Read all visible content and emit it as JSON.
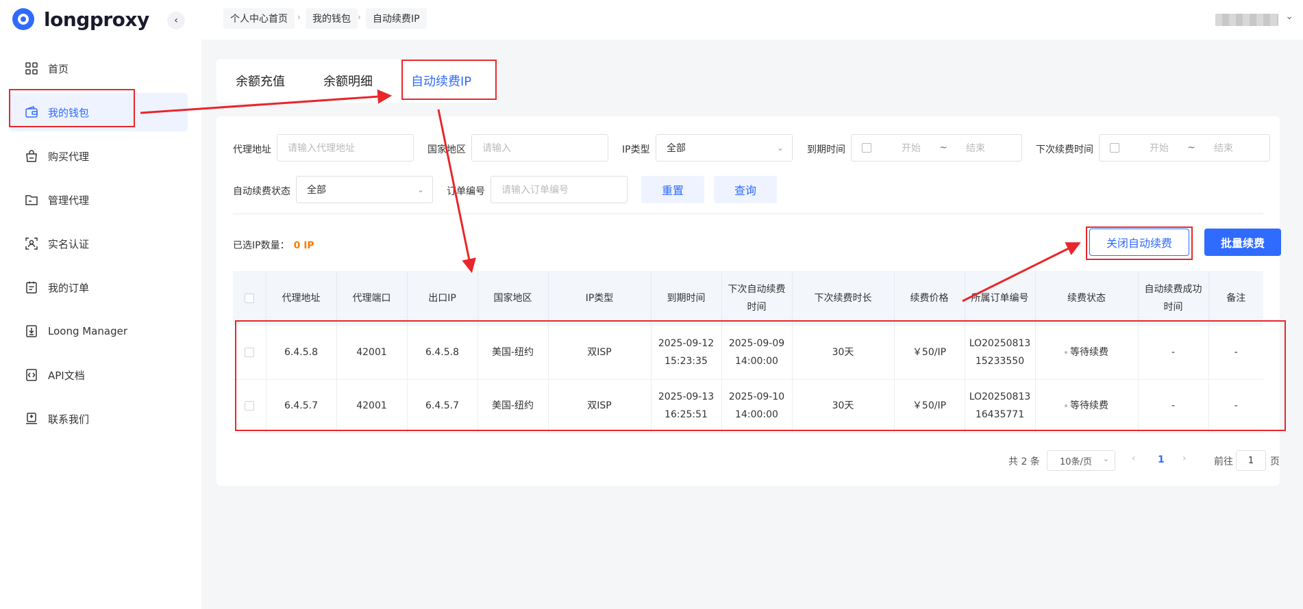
{
  "app": {
    "logo_part1": "lo",
    "logo_o": "o",
    "logo_part2": "ngproxy"
  },
  "sidebar": {
    "items": [
      {
        "label": "首页",
        "icon": "grid-icon"
      },
      {
        "label": "我的钱包",
        "icon": "wallet-icon"
      },
      {
        "label": "购买代理",
        "icon": "shopping-bag-icon"
      },
      {
        "label": "管理代理",
        "icon": "folder-icon"
      },
      {
        "label": "实名认证",
        "icon": "id-scan-icon"
      },
      {
        "label": "我的订单",
        "icon": "clipboard-icon"
      },
      {
        "label": "Loong Manager",
        "icon": "download-icon"
      },
      {
        "label": "API文档",
        "icon": "code-doc-icon"
      },
      {
        "label": "联系我们",
        "icon": "contact-icon"
      }
    ],
    "active_index": 1
  },
  "breadcrumb": [
    "个人中心首页",
    "我的钱包",
    "自动续费IP"
  ],
  "tabs": [
    {
      "label": "余额充值"
    },
    {
      "label": "余额明细"
    },
    {
      "label": "自动续费IP"
    }
  ],
  "filters": {
    "proxy_address": {
      "label": "代理地址",
      "placeholder": "请输入代理地址"
    },
    "country": {
      "label": "国家地区",
      "placeholder": "请输入"
    },
    "ip_type": {
      "label": "IP类型",
      "value": "全部"
    },
    "expire_time": {
      "label": "到期时间",
      "start": "开始",
      "sep": "~",
      "end": "结束"
    },
    "next_renew_time": {
      "label": "下次续费时间",
      "start": "开始",
      "sep": "~",
      "end": "结束"
    },
    "auto_renew_status": {
      "label": "自动续费状态",
      "value": "全部"
    },
    "order_no": {
      "label": "订单编号",
      "placeholder": "请输入订单编号"
    },
    "reset_label": "重置",
    "query_label": "查询"
  },
  "selection": {
    "label": "已选IP数量：",
    "count": "0 IP"
  },
  "actions": {
    "close_auto_renew": "关闭自动续费",
    "batch_renew": "批量续费"
  },
  "table": {
    "headers": [
      "代理地址",
      "代理端口",
      "出口IP",
      "国家地区",
      "IP类型",
      "到期时间",
      "下次自动续费时间",
      "下次续费时长",
      "续费价格",
      "所属订单编号",
      "续费状态",
      "自动续费成功时间",
      "备注"
    ],
    "rows": [
      {
        "address": "6.4.5.8",
        "port": "42001",
        "exit_ip": "6.4.5.8",
        "region": "美国-纽约",
        "type": "双ISP",
        "expire_date": "2025-09-12",
        "expire_time": "15:23:35",
        "next_date": "2025-09-09",
        "next_time": "14:00:00",
        "duration": "30天",
        "price": "￥50/IP",
        "order_a": "LO20250813",
        "order_b": "15233550",
        "status": "等待续费",
        "success_time": "-",
        "remark": "-"
      },
      {
        "address": "6.4.5.7",
        "port": "42001",
        "exit_ip": "6.4.5.7",
        "region": "美国-纽约",
        "type": "双ISP",
        "expire_date": "2025-09-13",
        "expire_time": "16:25:51",
        "next_date": "2025-09-10",
        "next_time": "14:00:00",
        "duration": "30天",
        "price": "￥50/IP",
        "order_a": "LO20250813",
        "order_b": "16435771",
        "status": "等待续费",
        "success_time": "-",
        "remark": "-"
      }
    ]
  },
  "pagination": {
    "total": "共 2 条",
    "page_size": "10条/页",
    "current": "1",
    "goto_label": "前往",
    "goto_value": "1",
    "page_suffix": "页"
  },
  "colors": {
    "accent": "#2f6bff",
    "annotation": "#e8262b",
    "count": "#ff7a00"
  }
}
